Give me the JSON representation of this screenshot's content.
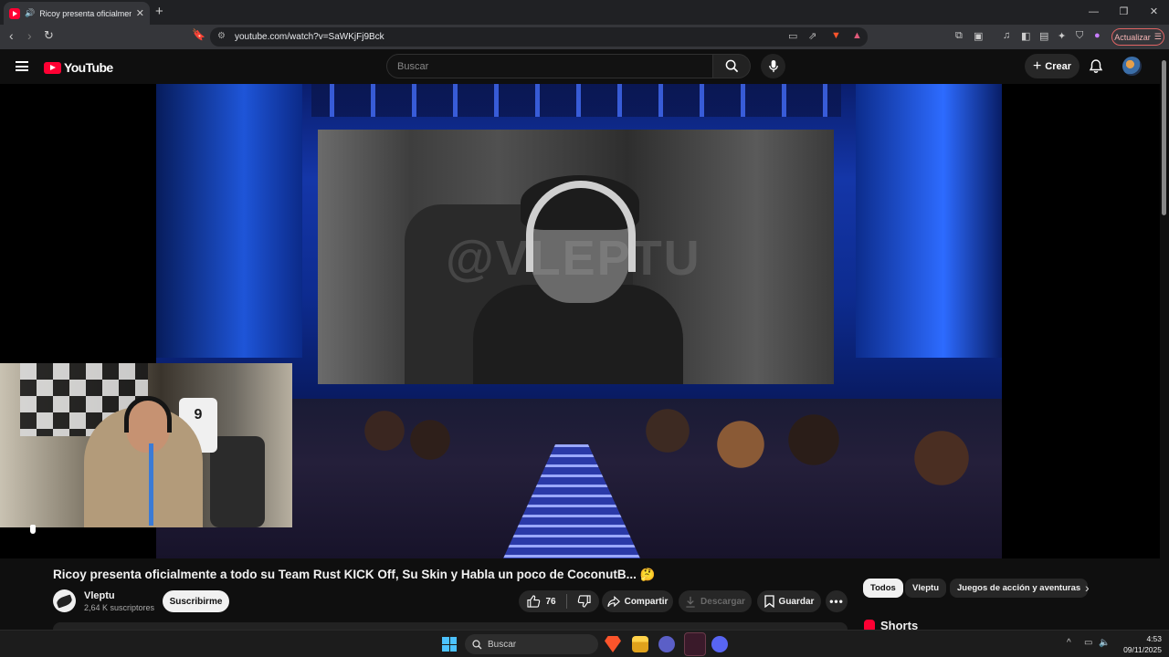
{
  "browser": {
    "tab_title": "Ricoy presenta oficialmente a",
    "new_tab": "+",
    "url": "youtube.com/watch?v=SaWKjFj9Bck",
    "update_label": "Actualizar",
    "window_controls": [
      "—",
      "❐",
      "✕"
    ]
  },
  "youtube": {
    "logo_text": "YouTube",
    "search_placeholder": "Buscar",
    "create_label": "Crear"
  },
  "video": {
    "watermark": "@VLEPTU",
    "jersey_number": "9",
    "title": "Ricoy presenta oficialmente a todo su Team Rust KICK Off, Su Skin y Habla un poco de CoconutB... 🤔",
    "channel_name": "Vleptu",
    "subscribers": "2,64 K suscriptores",
    "subscribe_label": "Suscribirme",
    "like_count": "76",
    "share_label": "Compartir",
    "download_label": "Descargar",
    "save_label": "Guardar"
  },
  "sidebar": {
    "chips": [
      "Todos",
      "Vleptu",
      "Juegos de acción y aventuras"
    ],
    "shorts_heading": "Shorts"
  },
  "taskbar": {
    "search_label": "Buscar",
    "time": "4:53",
    "date": "09/11/2025"
  },
  "colors": {
    "yt_red": "#ff0033",
    "background": "#0f0f0f",
    "chip_bg": "#272727"
  }
}
